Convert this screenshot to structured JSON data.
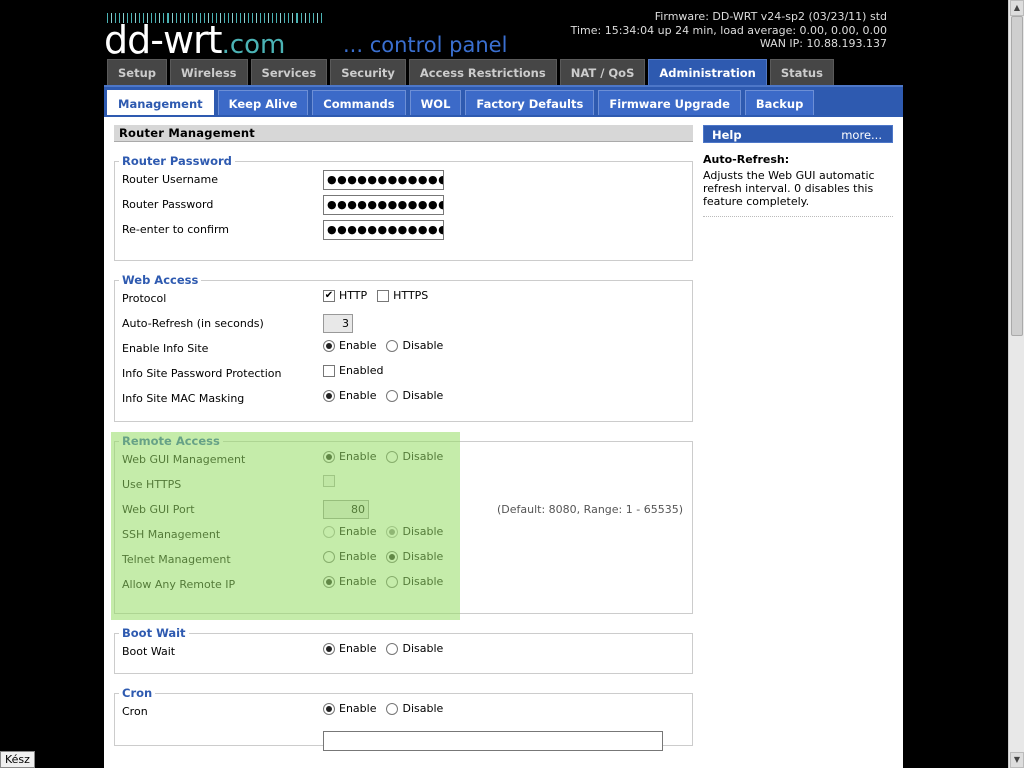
{
  "header": {
    "logo_main": "dd-wrt",
    "logo_suffix": ".com",
    "logo_tagline": "... control panel",
    "firmware": "Firmware: DD-WRT v24-sp2 (03/23/11) std",
    "time": "Time: 15:34:04 up 24 min, load average: 0.00, 0.00, 0.00",
    "wan_ip": "WAN IP: 10.88.193.137"
  },
  "main_tabs": [
    "Setup",
    "Wireless",
    "Services",
    "Security",
    "Access Restrictions",
    "NAT / QoS",
    "Administration",
    "Status"
  ],
  "sub_tabs": [
    "Management",
    "Keep Alive",
    "Commands",
    "WOL",
    "Factory Defaults",
    "Firmware Upgrade",
    "Backup"
  ],
  "page_title": "Router Management",
  "router_password": {
    "legend": "Router Password",
    "username_label": "Router Username",
    "username_value": "●●●●●●●●●●●●●●●●",
    "password_label": "Router Password",
    "password_value": "●●●●●●●●●●●●●●●●",
    "confirm_label": "Re-enter to confirm",
    "confirm_value": "●●●●●●●●●●●●●●●●"
  },
  "web_access": {
    "legend": "Web Access",
    "protocol_label": "Protocol",
    "http": "HTTP",
    "https": "HTTPS",
    "refresh_label": "Auto-Refresh (in seconds)",
    "refresh_value": "3",
    "info_site_label": "Enable Info Site",
    "info_pw_label": "Info Site Password Protection",
    "enabled": "Enabled",
    "mac_label": "Info Site MAC Masking"
  },
  "remote_access": {
    "legend": "Remote Access",
    "gui_label": "Web GUI Management",
    "https_label": "Use HTTPS",
    "port_label": "Web GUI Port",
    "port_value": "80",
    "port_note": "(Default: 8080, Range: 1 - 65535)",
    "ssh_label": "SSH Management",
    "telnet_label": "Telnet Management",
    "remote_ip_label": "Allow Any Remote IP"
  },
  "boot_wait": {
    "legend": "Boot Wait",
    "label": "Boot Wait"
  },
  "cron": {
    "legend": "Cron",
    "label": "Cron"
  },
  "common": {
    "enable": "Enable",
    "disable": "Disable"
  },
  "help": {
    "title": "Help",
    "more": "more...",
    "heading": "Auto-Refresh:",
    "text": "Adjusts the Web GUI automatic refresh interval. 0 disables this feature completely."
  },
  "status_bar": "Kész",
  "colors": {
    "accent": "#2e5ab0",
    "logo_teal": "#4bb3b5",
    "highlight": "#b8e6a0"
  }
}
